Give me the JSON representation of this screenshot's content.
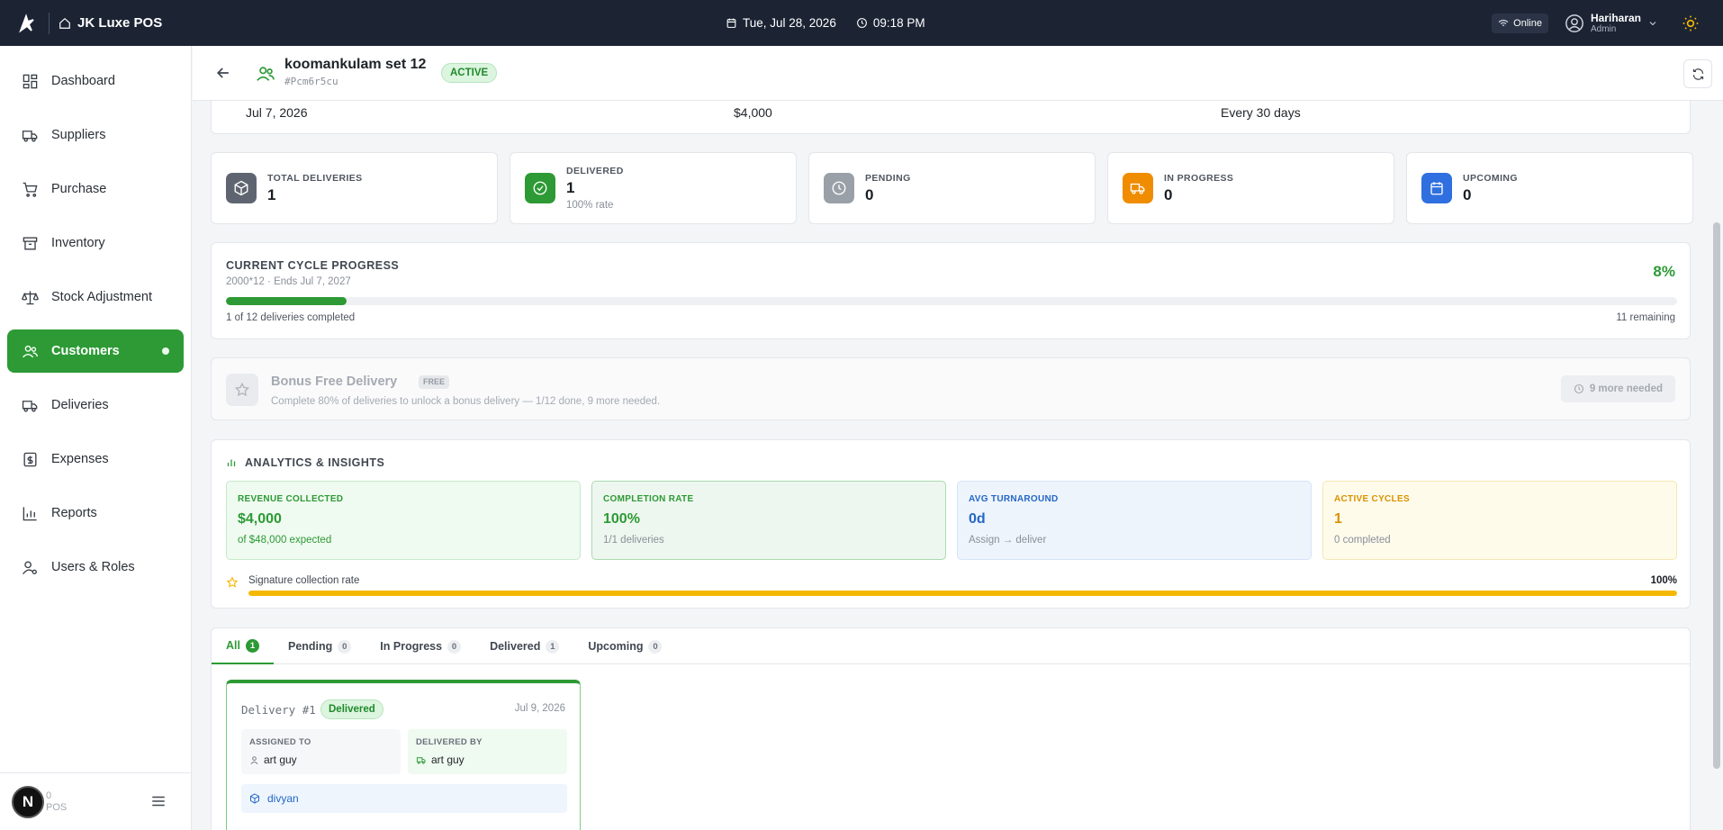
{
  "topbar": {
    "app_title": "JK Luxe POS",
    "date": "Tue, Jul 28, 2026",
    "time": "09:18 PM",
    "status": "Online",
    "user_name": "Hariharan",
    "user_role": "Admin"
  },
  "sidebar": {
    "items": [
      {
        "label": "Dashboard",
        "icon": "dashboard-icon"
      },
      {
        "label": "Suppliers",
        "icon": "truck-icon"
      },
      {
        "label": "Purchase",
        "icon": "cart-icon"
      },
      {
        "label": "Inventory",
        "icon": "archive-icon"
      },
      {
        "label": "Stock Adjustment",
        "icon": "scale-icon"
      },
      {
        "label": "Customers",
        "icon": "users-icon",
        "active": true
      },
      {
        "label": "Deliveries",
        "icon": "truck-icon"
      },
      {
        "label": "Expenses",
        "icon": "receipt-icon"
      },
      {
        "label": "Reports",
        "icon": "chart-icon"
      },
      {
        "label": "Users & Roles",
        "icon": "user-cog-icon"
      }
    ],
    "footer_badge": "N",
    "footer_ver_1": "0",
    "footer_ver_2": "POS"
  },
  "header": {
    "title": "koomankulam set 12",
    "id": "#Pcm6r5cu",
    "status_badge": "ACTIVE"
  },
  "info_strip": {
    "start_date": "Jul 7, 2026",
    "amount": "$4,000",
    "frequency": "Every 30 days"
  },
  "stats": [
    {
      "label": "TOTAL DELIVERIES",
      "value": "1",
      "sub": "",
      "color": "#5f6570",
      "icon": "box-icon"
    },
    {
      "label": "DELIVERED",
      "value": "1",
      "sub": "100% rate",
      "color": "#2d9a35",
      "icon": "check-circle-icon"
    },
    {
      "label": "PENDING",
      "value": "0",
      "sub": "",
      "color": "#9aa0a8",
      "icon": "clock-icon"
    },
    {
      "label": "IN PROGRESS",
      "value": "0",
      "sub": "",
      "color": "#f08c00",
      "icon": "truck-icon"
    },
    {
      "label": "UPCOMING",
      "value": "0",
      "sub": "",
      "color": "#2f6fe0",
      "icon": "calendar-icon"
    }
  ],
  "cycle": {
    "title": "CURRENT CYCLE PROGRESS",
    "subtitle": "2000*12 · Ends Jul 7, 2027",
    "percent_label": "8%",
    "progress_fraction": 0.083,
    "completed_text": "1 of 12 deliveries completed",
    "remaining_text": "11 remaining"
  },
  "bonus": {
    "title": "Bonus Free Delivery",
    "tag": "FREE",
    "description": "Complete 80% of deliveries to unlock a bonus delivery — 1/12 done, 9 more needed.",
    "button": "9 more needed"
  },
  "analytics": {
    "title": "ANALYTICS & INSIGHTS",
    "metrics": [
      {
        "label": "REVENUE COLLECTED",
        "value": "$4,000",
        "sub": "of $48,000 expected",
        "color": "#2d9a35",
        "bg": "#effaf0",
        "border": "#c6eacb",
        "subcolor": "#2d9a35"
      },
      {
        "label": "COMPLETION RATE",
        "value": "100%",
        "sub": "1/1 deliveries",
        "color": "#2d9a35",
        "bg": "#eef7ef",
        "border": "#a9d9af",
        "subcolor": "#8a8f98"
      },
      {
        "label": "AVG TURNAROUND",
        "value": "0d",
        "sub": "Assign → deliver",
        "color": "#2567c7",
        "bg": "#eef4fc",
        "border": "#d6e4f7",
        "subcolor": "#8a8f98"
      },
      {
        "label": "ACTIVE CYCLES",
        "value": "1",
        "sub": "0 completed",
        "color": "#d99300",
        "bg": "#fefbeb",
        "border": "#f5e7b3",
        "subcolor": "#8a8f98"
      }
    ],
    "signature_label": "Signature collection rate",
    "signature_value": "100%",
    "signature_fraction": 1.0
  },
  "tabs": [
    {
      "label": "All",
      "count": "1",
      "active": true
    },
    {
      "label": "Pending",
      "count": "0"
    },
    {
      "label": "In Progress",
      "count": "0"
    },
    {
      "label": "Delivered",
      "count": "1"
    },
    {
      "label": "Upcoming",
      "count": "0"
    }
  ],
  "delivery": {
    "number": "Delivery #1",
    "status": "Delivered",
    "date": "Jul 9, 2026",
    "assigned_label": "ASSIGNED TO",
    "assigned_value": "art guy",
    "delivered_label": "DELIVERED BY",
    "delivered_value": "art guy",
    "product": "divyan"
  }
}
